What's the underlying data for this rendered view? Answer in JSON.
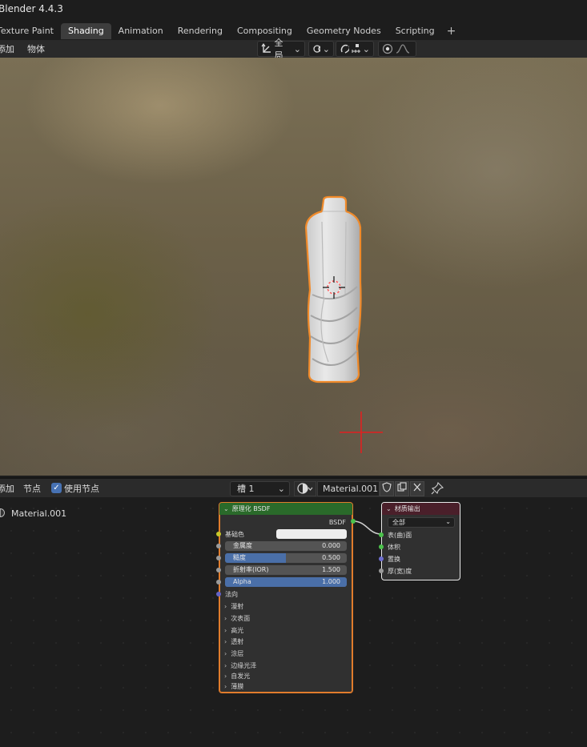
{
  "window": {
    "title": "Blender 4.4.3"
  },
  "workspace_tabs": [
    {
      "label": "Texture Paint",
      "active": false
    },
    {
      "label": "Shading",
      "active": true
    },
    {
      "label": "Animation",
      "active": false
    },
    {
      "label": "Rendering",
      "active": false
    },
    {
      "label": "Compositing",
      "active": false
    },
    {
      "label": "Geometry Nodes",
      "active": false
    },
    {
      "label": "Scripting",
      "active": false
    }
  ],
  "add_tab_glyph": "+",
  "viewport_header": {
    "menu_add": "添加",
    "menu_object": "物体",
    "transform_orientation": "全局",
    "dropdown_glyph": "⌄"
  },
  "node_header": {
    "menu_add": "添加",
    "menu_node": "节点",
    "use_nodes_label": "使用节点",
    "use_nodes_checked": true,
    "slot": "槽 1",
    "material_name": "Material.001"
  },
  "node_tree": {
    "material_label": "Material.001",
    "bsdf_node": {
      "title": "原理化 BSDF",
      "output_socket": "BSDF",
      "base_color_label": "基础色",
      "base_color": "#eeeeee",
      "sliders": [
        {
          "label": "金属度",
          "value": "0.000",
          "fill": 0.0,
          "highlight": false
        },
        {
          "label": "糙度",
          "value": "0.500",
          "fill": 0.5,
          "highlight": true
        },
        {
          "label": "折射率(IOR)",
          "value": "1.500",
          "fill": 0.0,
          "highlight": false
        },
        {
          "label": "Alpha",
          "value": "1.000",
          "fill": 1.0,
          "highlight": true
        }
      ],
      "normal_label": "法向",
      "panels": [
        "漫射",
        "次表面",
        "高光",
        "透射",
        "涂层",
        "边缘光泽",
        "自发光",
        "薄膜"
      ]
    },
    "output_node": {
      "title": "材质输出",
      "target": "全部",
      "inputs": [
        "表(曲)面",
        "体积",
        "置换",
        "厚(宽)度"
      ]
    }
  },
  "colors": {
    "accent_blue": "#4772b3",
    "selection_orange": "#e07c2c",
    "bsdf_header_green": "#2a6a2a",
    "output_header_maroon": "#4a1f2a"
  }
}
